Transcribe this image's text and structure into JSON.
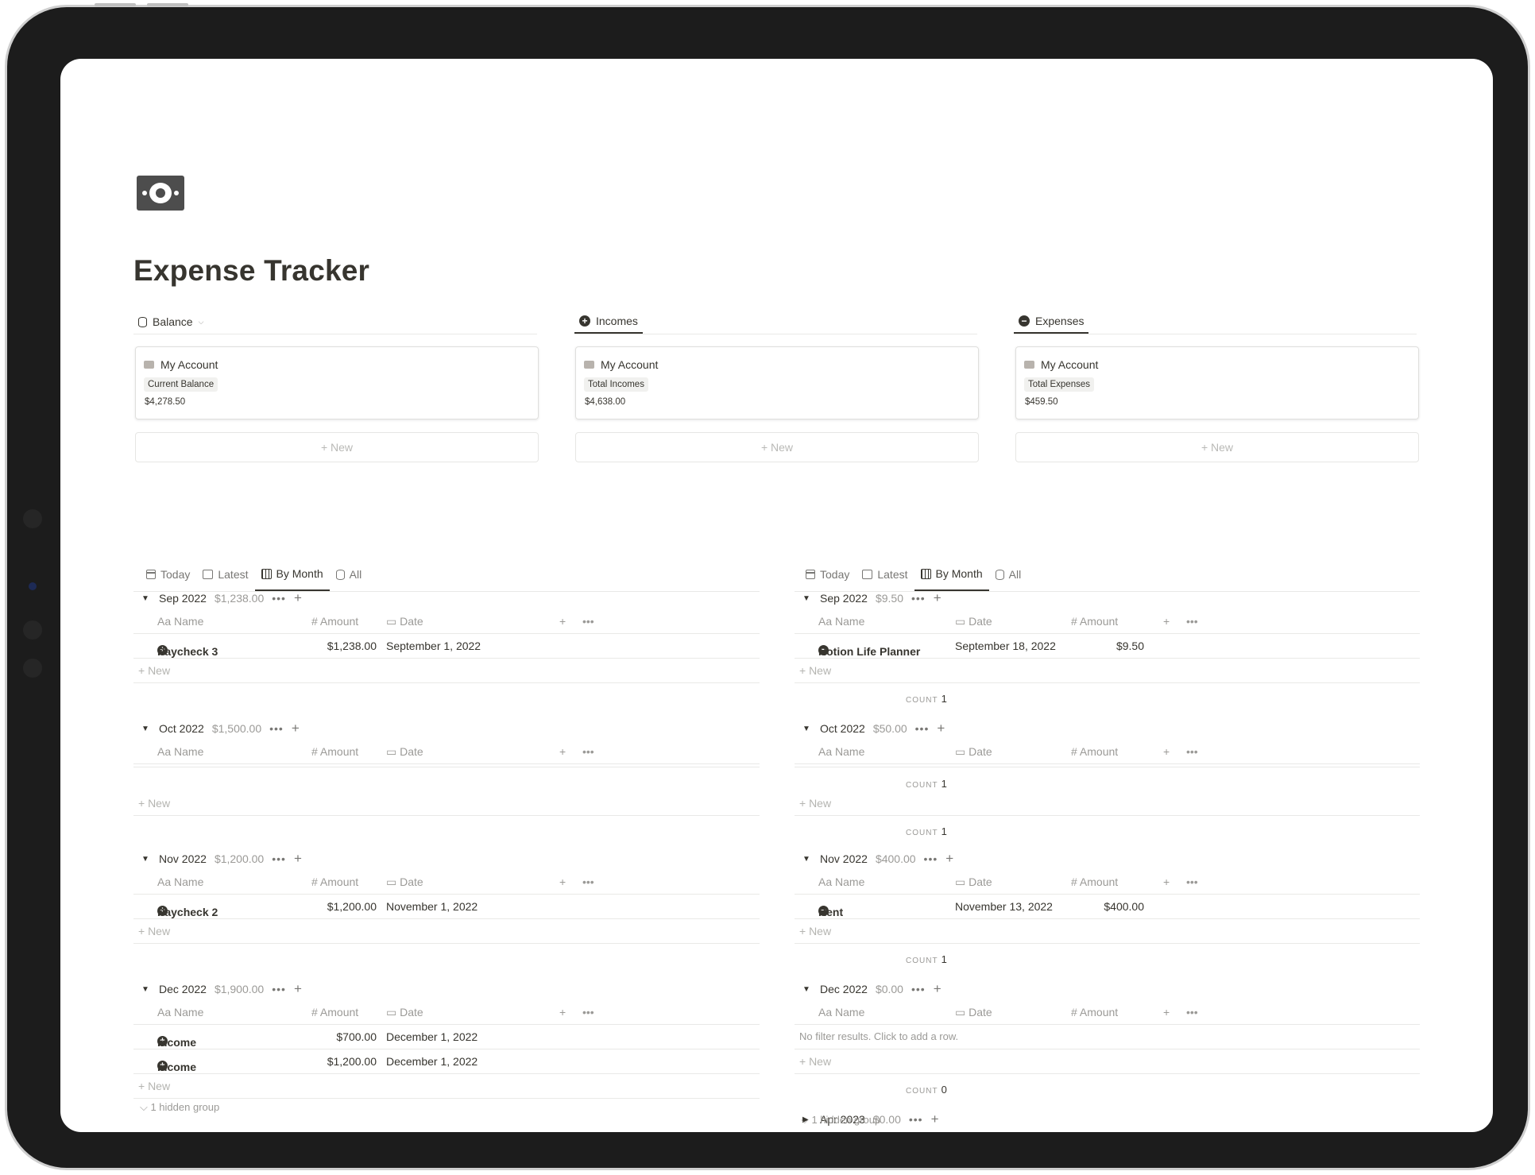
{
  "page": {
    "title": "Expense Tracker",
    "icon": "money-bill-icon"
  },
  "galleries": [
    {
      "tab": "Balance",
      "card_name": "My Account",
      "tag": "Current Balance",
      "value": "$4,278.50",
      "new": "New"
    },
    {
      "tab": "Incomes",
      "card_name": "My Account",
      "tag": "Total Incomes",
      "value": "$4,638.00",
      "new": "New"
    },
    {
      "tab": "Expenses",
      "card_name": "My Account",
      "tag": "Total Expenses",
      "value": "$459.50",
      "new": "New"
    }
  ],
  "view_tabs": [
    "Today",
    "Latest",
    "By Month",
    "All"
  ],
  "columns": {
    "name": "Name",
    "amount": "Amount",
    "date": "Date",
    "aa": "Aa",
    "hash": "#"
  },
  "new_label": "New",
  "count_label": "COUNT",
  "incomes": {
    "groups": [
      {
        "month": "Sep 2022",
        "sum": "$1,238.00",
        "rows": [
          {
            "name": "Paycheck 3",
            "amount": "$1,238.00",
            "date": "September 1, 2022"
          }
        ]
      },
      {
        "month": "Oct 2022",
        "sum": "$1,500.00",
        "rows": []
      },
      {
        "month": "Nov 2022",
        "sum": "$1,200.00",
        "rows": [
          {
            "name": "Paycheck 2",
            "amount": "$1,200.00",
            "date": "November 1, 2022"
          }
        ]
      },
      {
        "month": "Dec 2022",
        "sum": "$1,900.00",
        "rows": [
          {
            "name": "Income",
            "amount": "$700.00",
            "date": "December 1, 2022"
          },
          {
            "name": "Income",
            "amount": "$1,200.00",
            "date": "December 1, 2022"
          }
        ]
      }
    ],
    "hidden": "1 hidden group"
  },
  "expenses": {
    "groups": [
      {
        "month": "Sep 2022",
        "sum": "$9.50",
        "rows": [
          {
            "name": "Notion Life Planner",
            "date": "September 18, 2022",
            "amount": "$9.50"
          }
        ],
        "count": "1"
      },
      {
        "month": "Oct 2022",
        "sum": "$50.00",
        "rows": [],
        "count": "1",
        "count_after": "1"
      },
      {
        "month": "Nov 2022",
        "sum": "$400.00",
        "rows": [
          {
            "name": "Rent",
            "date": "November 13, 2022",
            "amount": "$400.00"
          }
        ],
        "count": "1"
      },
      {
        "month": "Dec 2022",
        "sum": "$0.00",
        "rows": [],
        "no_results": "No filter results. Click to add a row.",
        "count": "0"
      },
      {
        "month": "Apr 2023",
        "sum": "$0.00",
        "collapsed": true
      }
    ],
    "hidden": "1 hidden group"
  }
}
